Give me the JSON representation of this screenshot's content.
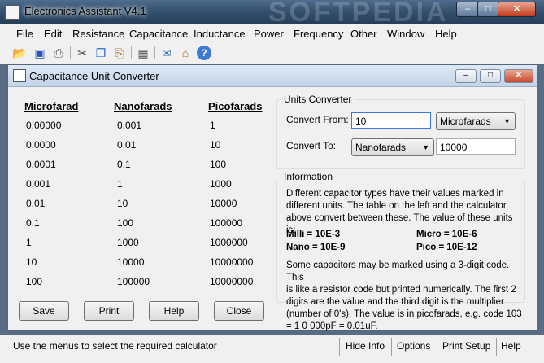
{
  "window": {
    "title": "Electronics Assistant V4.1",
    "watermark": "SOFTPEDIA",
    "minimize": "–",
    "maximize": "□",
    "close": "✕"
  },
  "menu": [
    "File",
    "Edit",
    "Resistance",
    "Capacitance",
    "Inductance",
    "Power",
    "Frequency",
    "Other",
    "Window",
    "Help"
  ],
  "toolbar": {
    "icons": [
      "open-folder-icon",
      "save-icon",
      "print-icon",
      "cut-icon",
      "copy-icon",
      "paste-icon",
      "calculator-icon",
      "email-icon",
      "home-icon",
      "help-icon"
    ]
  },
  "child": {
    "title": "Capacitance Unit Converter"
  },
  "table": {
    "headers": [
      "Microfarad",
      "Nanofarads",
      "Picofarads"
    ],
    "rows": [
      [
        "0.00000",
        "0.001",
        "1"
      ],
      [
        "0.0000",
        "0.01",
        "10"
      ],
      [
        "0.0001",
        "0.1",
        "100"
      ],
      [
        "0.001",
        "1",
        "1000"
      ],
      [
        "0.01",
        "10",
        "10000"
      ],
      [
        "0.1",
        "100",
        "100000"
      ],
      [
        "1",
        "1000",
        "1000000"
      ],
      [
        "10",
        "10000",
        "10000000"
      ],
      [
        "100",
        "100000",
        "10000000"
      ]
    ]
  },
  "buttons": {
    "save": "Save",
    "print": "Print",
    "help": "Help",
    "close": "Close"
  },
  "converter": {
    "title": "Units Converter",
    "from_label": "Convert From:",
    "from_value": "10",
    "from_unit": "Microfarads",
    "to_label": "Convert To:",
    "to_unit": "Nanofarads",
    "result": "10000"
  },
  "information": {
    "title": "Information",
    "para1": [
      "Different capacitor types have their values marked in",
      "different units. The table on the left and the calculator",
      "above convert between these. The value of these units is:"
    ],
    "units": {
      "milli": "Milli = 10E-3",
      "micro": "Micro = 10E-6",
      "nano": "Nano = 10E-9",
      "pico": "Pico = 10E-12"
    },
    "para2": [
      "Some capacitors may be marked using a 3-digit code. This",
      "is like a resistor code but printed numerically. The first 2",
      "digits are the value and the third digit is the multiplier",
      "(number of 0's). The value is in picofarads, e.g. code 103",
      "= 1 0 000pF = 0.01uF."
    ]
  },
  "status": {
    "message": "Use the menus to select the required calculator",
    "hide_info": "Hide Info",
    "options": "Options",
    "print_setup": "Print Setup",
    "help": "Help"
  }
}
